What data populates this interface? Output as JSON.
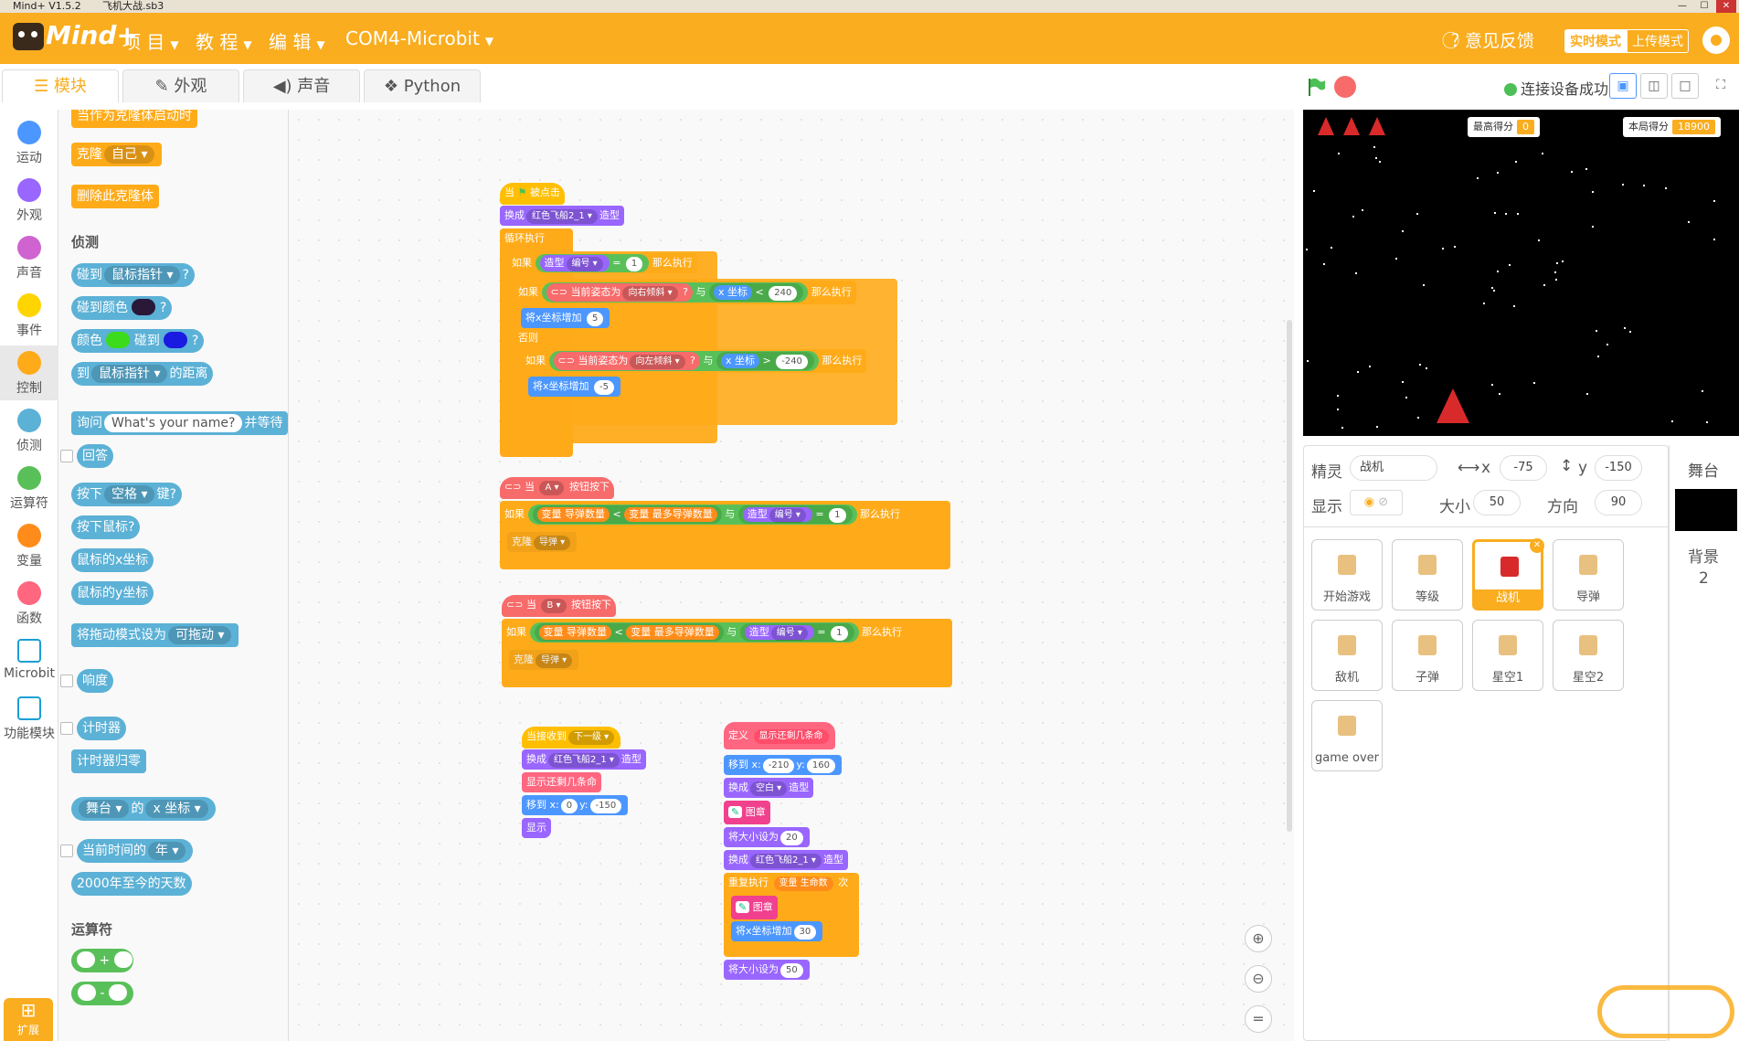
{
  "window": {
    "title": "Mind+ V1.5.2",
    "file": "飞机大战.sb3"
  },
  "menu": {
    "items": [
      "项 目",
      "教 程",
      "编 辑",
      "COM4-Microbit"
    ],
    "feedback": "意见反馈",
    "mode_realtime": "实时模式",
    "mode_upload": "上传模式"
  },
  "tabs": [
    "模块",
    "外观",
    "声音",
    "Python"
  ],
  "status": {
    "connection": "连接设备成功"
  },
  "categories": [
    {
      "label": "运动",
      "color": "#4c97ff"
    },
    {
      "label": "外观",
      "color": "#9966ff"
    },
    {
      "label": "声音",
      "color": "#cf63cf"
    },
    {
      "label": "事件",
      "color": "#ffd500"
    },
    {
      "label": "控制",
      "color": "#ffab19"
    },
    {
      "label": "侦测",
      "color": "#5cb1d6"
    },
    {
      "label": "运算符",
      "color": "#59c059"
    },
    {
      "label": "变量",
      "color": "#ff8c1a"
    },
    {
      "label": "函数",
      "color": "#ff6680"
    },
    {
      "label": "Microbit",
      "color": "#ffffff"
    },
    {
      "label": "功能模块",
      "color": "#ffffff"
    }
  ],
  "palette": {
    "b1": "当作为克隆体启动时",
    "clone": "克隆",
    "self": "自己",
    "del": "删除此克隆体",
    "sensing_title": "侦测",
    "touch": "碰到",
    "mouse": "鼠标指针",
    "touchcolor": "碰到颜色",
    "color": "颜色",
    "touch2": "碰到",
    "to": "到",
    "dist": "的距离",
    "ask": "询问",
    "askdef": "What's your name?",
    "wait": "并等待",
    "answer": "回答",
    "press": "按下",
    "space": "空格",
    "key": "键?",
    "mousedown": "按下鼠标?",
    "mx": "鼠标的x坐标",
    "my": "鼠标的y坐标",
    "drag": "将拖动模式设为",
    "draggable": "可拖动",
    "loud": "响度",
    "timer": "计时器",
    "timerreset": "计时器归零",
    "stage": "舞台",
    "of": "的",
    "xpos": "x 坐标",
    "curtime": "当前时间的",
    "year": "年",
    "days": "2000年至今的天数",
    "op_title": "运算符",
    "q": "?",
    "plus": "+",
    "minus": "-"
  },
  "scripts": {
    "s1": {
      "hat": "当",
      "flag": "被点击",
      "l1a": "换成",
      "l1b": "红色飞船2_1",
      "l1c": "造型",
      "loop": "循环执行",
      "if": "如果",
      "costume": "造型",
      "num": "编号",
      "eq": "=",
      "one": "1",
      "then": "那么执行",
      "if2": "如果",
      "tilt": "当前姿态为",
      "right": "向右倾斜",
      "and": "与",
      "x": "x 坐标",
      "lt": "<",
      "v240": "240",
      "then2": "那么执行",
      "chg": "将x坐标增加",
      "v5": "5",
      "else": "否则",
      "if3": "如果",
      "tilt2": "当前姿态为",
      "left": "向左倾斜",
      "and2": "与",
      "x2": "x 坐标",
      "gt": ">",
      "vm240": "-240",
      "then3": "那么执行",
      "chg2": "将x坐标增加",
      "vm5": "-5"
    },
    "s2": {
      "hat": "当",
      "btn": "A",
      "pressed": "按钮按下",
      "if": "如果",
      "var": "变量",
      "bullets": "导弹数量",
      "lt": "<",
      "var2": "变量",
      "maxb": "最多导弹数量",
      "and": "与",
      "costume": "造型",
      "num": "编号",
      "eq": "=",
      "one": "1",
      "then": "那么执行",
      "clone": "克隆",
      "missile": "导弹"
    },
    "s3": {
      "hat": "当",
      "btn": "B",
      "pressed": "按钮按下",
      "if": "如果",
      "var": "变量",
      "bullets": "导弹数量",
      "lt": "<",
      "var2": "变量",
      "maxb": "最多导弹数量",
      "and": "与",
      "costume": "造型",
      "num": "编号",
      "eq": "=",
      "one": "1",
      "then": "那么执行",
      "clone": "克隆",
      "missile": "导弹"
    },
    "s4": {
      "hat": "当接收到",
      "msg": "下一级",
      "sw": "换成",
      "cos": "红色飞船2_1",
      "cosl": "造型",
      "show_lives": "显示还剩几条命",
      "goto": "移到 x:",
      "x0": "0",
      "y": "y:",
      "ym150": "-150",
      "show": "显示"
    },
    "s5": {
      "def": "定义",
      "name": "显示还剩几条命",
      "goto": "移到 x:",
      "xm210": "-210",
      "y": "y:",
      "y160": "160",
      "sw": "换成",
      "empty": "空白",
      "cosl": "造型",
      "stamp": "图章",
      "size": "将大小设为",
      "s20": "20",
      "sw2": "换成",
      "cos": "红色飞船2_1",
      "cosl2": "造型",
      "rep": "重复执行",
      "var": "变量",
      "lives": "生命数",
      "times": "次",
      "stamp2": "图章",
      "chg": "将x坐标增加",
      "v30": "30",
      "size2": "将大小设为",
      "s50": "50"
    }
  },
  "stage": {
    "high_label": "最高得分",
    "high": "0",
    "cur_label": "本局得分",
    "cur": "18900"
  },
  "sprite_info": {
    "sprite_label": "精灵",
    "name": "战机",
    "x_label": "x",
    "x": "-75",
    "y_label": "y",
    "y": "-150",
    "show_label": "显示",
    "size_label": "大小",
    "size": "50",
    "dir_label": "方向",
    "dir": "90"
  },
  "sprites": [
    "开始游戏",
    "等级",
    "战机",
    "导弹",
    "敌机",
    "子弹",
    "星空1",
    "星空2",
    "game over"
  ],
  "stage_panel": {
    "title": "舞台",
    "bg_label": "背景",
    "bg_count": "2"
  },
  "extension": "扩展"
}
